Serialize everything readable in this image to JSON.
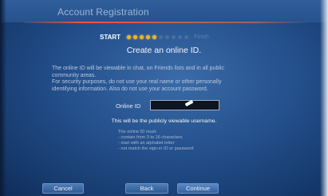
{
  "window": {
    "title": "Account Registration"
  },
  "progress": {
    "start_label": "START",
    "finish_label": "Finish",
    "completed_steps": 5,
    "total_steps": 10,
    "done_color": "#f2b21e",
    "todo_color": "#4a6e9e"
  },
  "main": {
    "heading": "Create an online ID.",
    "description_lines": [
      "The online ID will be viewable in chat, on Friends lists and in all public",
      "community areas.",
      "For security purposes, do not use your real name or other personally",
      "identifying information. Also do not use your account password."
    ],
    "online_id_label": "Online ID",
    "online_id_value": "",
    "public_note": "This will be the publicly viewable username.",
    "rules_lines": [
      "The online ID must:",
      "- contain from 3 to 16 characters",
      "- start with an alphabet letter",
      "- not match the sign-in ID or password"
    ]
  },
  "buttons": {
    "cancel": "Cancel",
    "back": "Back",
    "continue": "Continue"
  },
  "colors": {
    "background": "#24508c",
    "accent_line": "#ff5a28"
  }
}
